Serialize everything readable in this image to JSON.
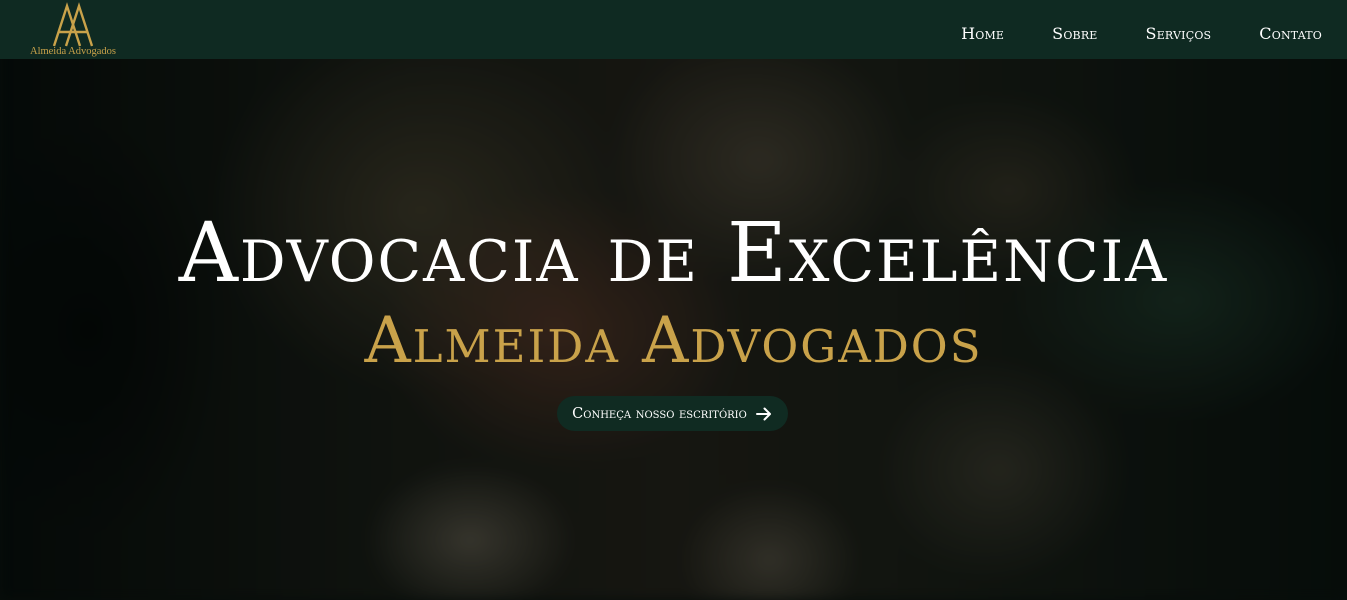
{
  "brand": {
    "name": "Almeida Advogados",
    "logo_icon": "aa-monogram-icon",
    "accent_color": "#c9a24a",
    "nav_background": "#0f2a22"
  },
  "nav": {
    "items": [
      {
        "label": "Home"
      },
      {
        "label": "Sobre"
      },
      {
        "label": "Serviços"
      },
      {
        "label": "Contato"
      }
    ]
  },
  "hero": {
    "title": "Advocacia de Excelência",
    "subtitle": "Almeida Advogados",
    "cta": {
      "label": "Conheça nosso escritório",
      "icon": "arrow-right-icon"
    }
  }
}
